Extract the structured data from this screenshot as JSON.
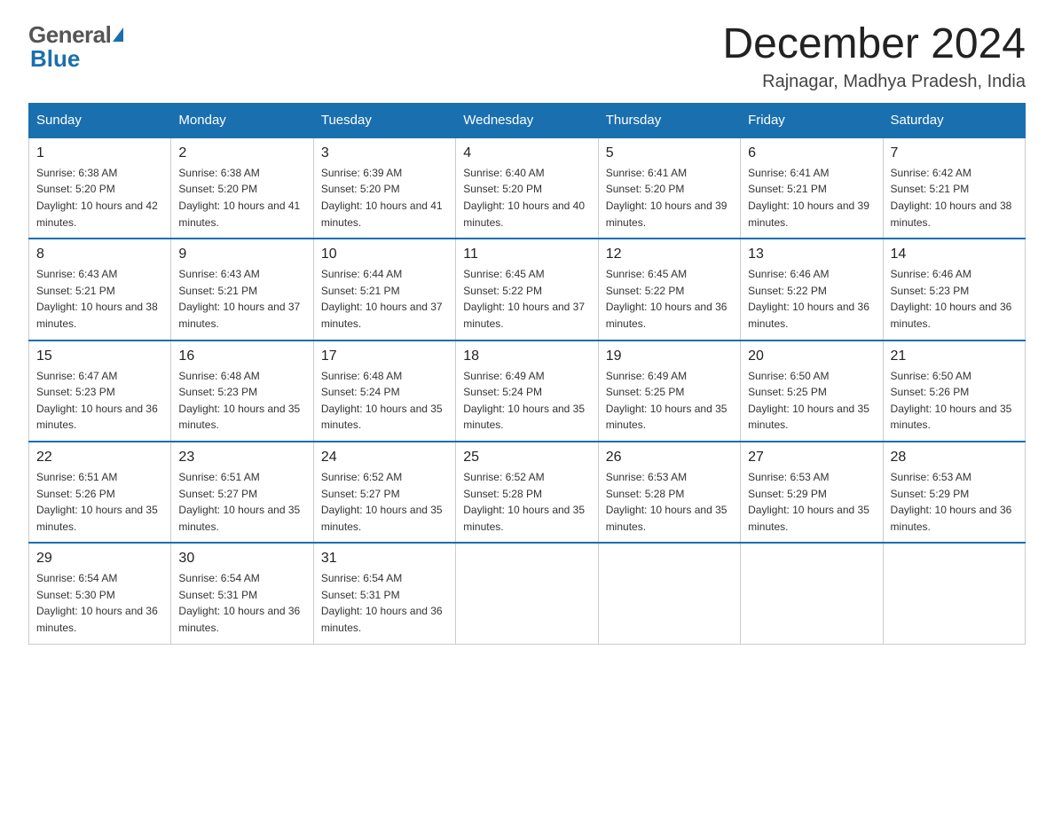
{
  "header": {
    "logo_general": "General",
    "logo_triangle": "▶",
    "logo_blue": "Blue",
    "month_year": "December 2024",
    "location": "Rajnagar, Madhya Pradesh, India"
  },
  "days_of_week": [
    "Sunday",
    "Monday",
    "Tuesday",
    "Wednesday",
    "Thursday",
    "Friday",
    "Saturday"
  ],
  "weeks": [
    [
      {
        "day": "1",
        "sunrise": "6:38 AM",
        "sunset": "5:20 PM",
        "daylight": "10 hours and 42 minutes."
      },
      {
        "day": "2",
        "sunrise": "6:38 AM",
        "sunset": "5:20 PM",
        "daylight": "10 hours and 41 minutes."
      },
      {
        "day": "3",
        "sunrise": "6:39 AM",
        "sunset": "5:20 PM",
        "daylight": "10 hours and 41 minutes."
      },
      {
        "day": "4",
        "sunrise": "6:40 AM",
        "sunset": "5:20 PM",
        "daylight": "10 hours and 40 minutes."
      },
      {
        "day": "5",
        "sunrise": "6:41 AM",
        "sunset": "5:20 PM",
        "daylight": "10 hours and 39 minutes."
      },
      {
        "day": "6",
        "sunrise": "6:41 AM",
        "sunset": "5:21 PM",
        "daylight": "10 hours and 39 minutes."
      },
      {
        "day": "7",
        "sunrise": "6:42 AM",
        "sunset": "5:21 PM",
        "daylight": "10 hours and 38 minutes."
      }
    ],
    [
      {
        "day": "8",
        "sunrise": "6:43 AM",
        "sunset": "5:21 PM",
        "daylight": "10 hours and 38 minutes."
      },
      {
        "day": "9",
        "sunrise": "6:43 AM",
        "sunset": "5:21 PM",
        "daylight": "10 hours and 37 minutes."
      },
      {
        "day": "10",
        "sunrise": "6:44 AM",
        "sunset": "5:21 PM",
        "daylight": "10 hours and 37 minutes."
      },
      {
        "day": "11",
        "sunrise": "6:45 AM",
        "sunset": "5:22 PM",
        "daylight": "10 hours and 37 minutes."
      },
      {
        "day": "12",
        "sunrise": "6:45 AM",
        "sunset": "5:22 PM",
        "daylight": "10 hours and 36 minutes."
      },
      {
        "day": "13",
        "sunrise": "6:46 AM",
        "sunset": "5:22 PM",
        "daylight": "10 hours and 36 minutes."
      },
      {
        "day": "14",
        "sunrise": "6:46 AM",
        "sunset": "5:23 PM",
        "daylight": "10 hours and 36 minutes."
      }
    ],
    [
      {
        "day": "15",
        "sunrise": "6:47 AM",
        "sunset": "5:23 PM",
        "daylight": "10 hours and 36 minutes."
      },
      {
        "day": "16",
        "sunrise": "6:48 AM",
        "sunset": "5:23 PM",
        "daylight": "10 hours and 35 minutes."
      },
      {
        "day": "17",
        "sunrise": "6:48 AM",
        "sunset": "5:24 PM",
        "daylight": "10 hours and 35 minutes."
      },
      {
        "day": "18",
        "sunrise": "6:49 AM",
        "sunset": "5:24 PM",
        "daylight": "10 hours and 35 minutes."
      },
      {
        "day": "19",
        "sunrise": "6:49 AM",
        "sunset": "5:25 PM",
        "daylight": "10 hours and 35 minutes."
      },
      {
        "day": "20",
        "sunrise": "6:50 AM",
        "sunset": "5:25 PM",
        "daylight": "10 hours and 35 minutes."
      },
      {
        "day": "21",
        "sunrise": "6:50 AM",
        "sunset": "5:26 PM",
        "daylight": "10 hours and 35 minutes."
      }
    ],
    [
      {
        "day": "22",
        "sunrise": "6:51 AM",
        "sunset": "5:26 PM",
        "daylight": "10 hours and 35 minutes."
      },
      {
        "day": "23",
        "sunrise": "6:51 AM",
        "sunset": "5:27 PM",
        "daylight": "10 hours and 35 minutes."
      },
      {
        "day": "24",
        "sunrise": "6:52 AM",
        "sunset": "5:27 PM",
        "daylight": "10 hours and 35 minutes."
      },
      {
        "day": "25",
        "sunrise": "6:52 AM",
        "sunset": "5:28 PM",
        "daylight": "10 hours and 35 minutes."
      },
      {
        "day": "26",
        "sunrise": "6:53 AM",
        "sunset": "5:28 PM",
        "daylight": "10 hours and 35 minutes."
      },
      {
        "day": "27",
        "sunrise": "6:53 AM",
        "sunset": "5:29 PM",
        "daylight": "10 hours and 35 minutes."
      },
      {
        "day": "28",
        "sunrise": "6:53 AM",
        "sunset": "5:29 PM",
        "daylight": "10 hours and 36 minutes."
      }
    ],
    [
      {
        "day": "29",
        "sunrise": "6:54 AM",
        "sunset": "5:30 PM",
        "daylight": "10 hours and 36 minutes."
      },
      {
        "day": "30",
        "sunrise": "6:54 AM",
        "sunset": "5:31 PM",
        "daylight": "10 hours and 36 minutes."
      },
      {
        "day": "31",
        "sunrise": "6:54 AM",
        "sunset": "5:31 PM",
        "daylight": "10 hours and 36 minutes."
      },
      null,
      null,
      null,
      null
    ]
  ],
  "labels": {
    "sunrise_prefix": "Sunrise: ",
    "sunset_prefix": "Sunset: ",
    "daylight_prefix": "Daylight: "
  }
}
